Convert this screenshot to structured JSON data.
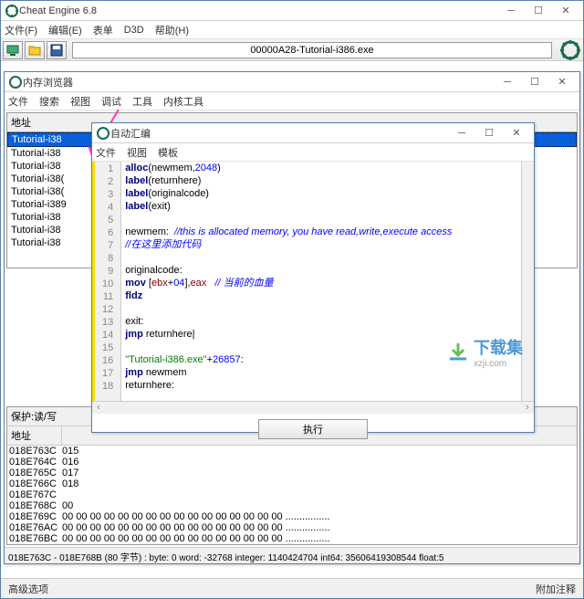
{
  "main": {
    "title": "Cheat Engine 6.8",
    "menu": [
      "文件(F)",
      "编辑(E)",
      "表单",
      "D3D",
      "帮助(H)"
    ],
    "target_process": "00000A28-Tutorial-i386.exe"
  },
  "memview": {
    "title": "内存浏览器",
    "menu": [
      "文件",
      "搜索",
      "视图",
      "调试",
      "工具",
      "内核工具"
    ],
    "addr_header": "地址",
    "addr_rows": [
      "Tutorial-i38",
      "Tutorial-i38",
      "Tutorial-i38",
      "Tutorial-i38(",
      "Tutorial-i38(",
      "Tutorial-i389",
      "Tutorial-i38",
      "Tutorial-i38",
      "Tutorial-i38"
    ],
    "hex_header": "保护:读/写",
    "hex_addr_label": "地址",
    "hex_rows": [
      {
        "addr": "018E763C",
        "col": "015"
      },
      {
        "addr": "018E764C",
        "col": "016"
      },
      {
        "addr": "018E765C",
        "col": "017"
      },
      {
        "addr": "018E766C",
        "col": "018"
      },
      {
        "addr": "018E767C",
        "bytes": ""
      },
      {
        "addr": "018E768C",
        "bytes": "00"
      },
      {
        "addr": "018E769C",
        "bytes": "00 00 00 00 00 00 00 00 00 00 00 00 00 00 00 00 ................"
      },
      {
        "addr": "018E76AC",
        "bytes": "00 00 00 00 00 00 00 00 00 00 00 00 00 00 00 00 ................"
      },
      {
        "addr": "018E76BC",
        "bytes": "00 00 00 00 00 00 00 00 00 00 00 00 00 00 00 00 ................"
      }
    ],
    "status": "018E763C - 018E768B (80 字节) : byte: 0 word: -32768 integer: 1140424704 int64: 35606419308544 float:5"
  },
  "asm": {
    "title": "自动汇编",
    "menu": [
      "文件",
      "视图",
      "模板"
    ],
    "exec_btn": "执行",
    "lines": [
      {
        "n": 1,
        "c": [
          {
            "t": "alloc",
            "k": "k"
          },
          {
            "t": "(newmem,"
          },
          {
            "t": "2048",
            "k": "n"
          },
          {
            "t": ")"
          }
        ]
      },
      {
        "n": 2,
        "c": [
          {
            "t": "label",
            "k": "k"
          },
          {
            "t": "(returnhere)"
          }
        ]
      },
      {
        "n": 3,
        "c": [
          {
            "t": "label",
            "k": "k"
          },
          {
            "t": "(originalcode)"
          }
        ]
      },
      {
        "n": 4,
        "c": [
          {
            "t": "label",
            "k": "k"
          },
          {
            "t": "(exit)"
          }
        ]
      },
      {
        "n": 5,
        "c": []
      },
      {
        "n": 6,
        "c": [
          {
            "t": "newmem:"
          },
          {
            "t": "  "
          },
          {
            "t": "//this is allocated memory, you have read,write,execute access",
            "k": "c"
          }
        ]
      },
      {
        "n": 7,
        "c": [
          {
            "t": "//在这里添加代码",
            "k": "c"
          }
        ]
      },
      {
        "n": 8,
        "c": []
      },
      {
        "n": 9,
        "c": [
          {
            "t": "originalcode:"
          }
        ]
      },
      {
        "n": 10,
        "c": [
          {
            "t": "mov",
            "k": "k"
          },
          {
            "t": " ["
          },
          {
            "t": "ebx",
            "k": "r"
          },
          {
            "t": "+"
          },
          {
            "t": "04",
            "k": "n"
          },
          {
            "t": "],"
          },
          {
            "t": "eax",
            "k": "r"
          },
          {
            "t": "   "
          },
          {
            "t": "// 当前的血量",
            "k": "c"
          }
        ]
      },
      {
        "n": 11,
        "c": [
          {
            "t": "fldz",
            "k": "k"
          }
        ]
      },
      {
        "n": 12,
        "c": []
      },
      {
        "n": 13,
        "c": [
          {
            "t": "exit:"
          }
        ]
      },
      {
        "n": 14,
        "c": [
          {
            "t": "jmp",
            "k": "k"
          },
          {
            "t": " returnhere"
          },
          {
            "t": "|"
          }
        ]
      },
      {
        "n": 15,
        "c": []
      },
      {
        "n": 16,
        "c": [
          {
            "t": "\"Tutorial-i386.exe\"",
            "k": "s"
          },
          {
            "t": "+"
          },
          {
            "t": "26857",
            "k": "n"
          },
          {
            "t": ":"
          }
        ]
      },
      {
        "n": 17,
        "c": [
          {
            "t": "jmp",
            "k": "k"
          },
          {
            "t": " newmem"
          }
        ]
      },
      {
        "n": 18,
        "c": [
          {
            "t": "returnhere:"
          }
        ]
      }
    ]
  },
  "footer": {
    "left": "高级选项",
    "right": "附加注释"
  },
  "watermark": {
    "t1": "下载集",
    "t2": "xzji.com"
  }
}
